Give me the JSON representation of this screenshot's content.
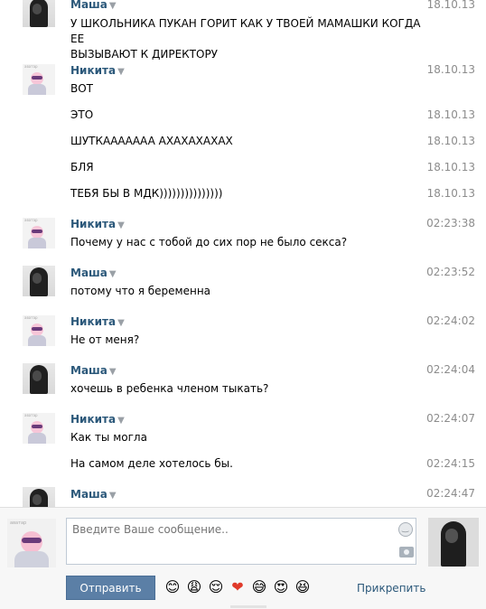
{
  "conversation": {
    "messages": [
      {
        "author": "Маша",
        "avatar": "masha",
        "time": "18.10.13",
        "lines": [
          "У ШКОЛЬНИКА ПУКАН ГОРИТ КАК У ТВОЕЙ МАМАШКИ КОГДА ЕЕ\nВЫЗЫВАЮТ К ДИРЕКТОРУ"
        ]
      },
      {
        "author": "Никита",
        "avatar": "nikita",
        "time": "18.10.13",
        "lines": [
          "ВОТ"
        ]
      },
      {
        "author": "",
        "avatar": "",
        "time": "18.10.13",
        "lines": [
          "ЭТО"
        ]
      },
      {
        "author": "",
        "avatar": "",
        "time": "18.10.13",
        "lines": [
          "ШУТКАААААAA АХАХАХАХАХ"
        ]
      },
      {
        "author": "",
        "avatar": "",
        "time": "18.10.13",
        "lines": [
          "БЛЯ"
        ]
      },
      {
        "author": "",
        "avatar": "",
        "time": "18.10.13",
        "lines": [
          "ТЕБЯ БЫ В МДК)))))))))))))))"
        ]
      },
      {
        "author": "Никита",
        "avatar": "nikita",
        "time": "02:23:38",
        "lines": [
          "Почему у нас с тобой до сих пор не было секса?"
        ]
      },
      {
        "author": "Маша",
        "avatar": "masha",
        "time": "02:23:52",
        "lines": [
          "потому что я беременна"
        ]
      },
      {
        "author": "Никита",
        "avatar": "nikita",
        "time": "02:24:02",
        "lines": [
          "Не от меня?"
        ]
      },
      {
        "author": "Маша",
        "avatar": "masha",
        "time": "02:24:04",
        "lines": [
          "хочешь в ребенка членом тыкать?"
        ]
      },
      {
        "author": "Никита",
        "avatar": "nikita",
        "time": "02:24:07",
        "lines": [
          "Как ты могла"
        ]
      },
      {
        "author": "",
        "avatar": "",
        "time": "02:24:15",
        "lines": [
          "На самом деле хотелось бы."
        ]
      },
      {
        "author": "Маша",
        "avatar": "masha",
        "time": "02:24:47",
        "lines": [
          ""
        ]
      }
    ]
  },
  "composer": {
    "placeholder": "Введите Ваше сообщение..",
    "send_label": "Отправить",
    "attach_label": "Прикрепить",
    "emojis": [
      "😊",
      "😩",
      "😌",
      "❤",
      "😅",
      "😍",
      "😆"
    ]
  },
  "colors": {
    "author": "#2b587a",
    "time": "#8c8c8c",
    "send_button": "#5b7fa6"
  },
  "icons": {
    "dropdown": "caret-down-icon",
    "smile": "smile-icon",
    "camera": "camera-icon"
  }
}
